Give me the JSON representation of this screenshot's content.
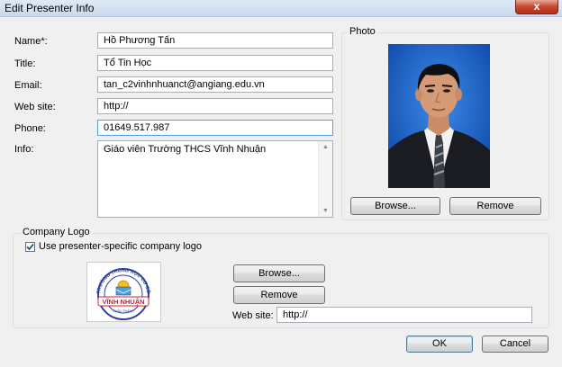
{
  "window": {
    "title": "Edit Presenter Info",
    "close_glyph": "x"
  },
  "form": {
    "name_label": "Name*:",
    "name_value": "Hồ Phương Tấn",
    "title_label": "Title:",
    "title_value": "Tổ Tin Học",
    "email_label": "Email:",
    "email_value": "tan_c2vinhnhuanct@angiang.edu.vn",
    "website_label": "Web site:",
    "website_value": "http://",
    "phone_label": "Phone:",
    "phone_value": "01649.517.987",
    "info_label": "Info:",
    "info_value": "Giáo viên Trường THCS Vĩnh Nhuận"
  },
  "photo": {
    "group_label": "Photo",
    "browse_label": "Browse...",
    "remove_label": "Remove"
  },
  "logo": {
    "group_label": "Company Logo",
    "checkbox_label": "Use presenter-specific company logo",
    "checkbox_checked": true,
    "browse_label": "Browse...",
    "remove_label": "Remove",
    "website_label": "Web site:",
    "website_value": "http://",
    "logo_top_text": "TRƯỜNG TRUNG HỌC CƠ SỞ",
    "logo_main_text": "VĨNH NHUẬN",
    "logo_sub_text": "CHÂU THÀNH"
  },
  "footer": {
    "ok_label": "OK",
    "cancel_label": "Cancel"
  }
}
